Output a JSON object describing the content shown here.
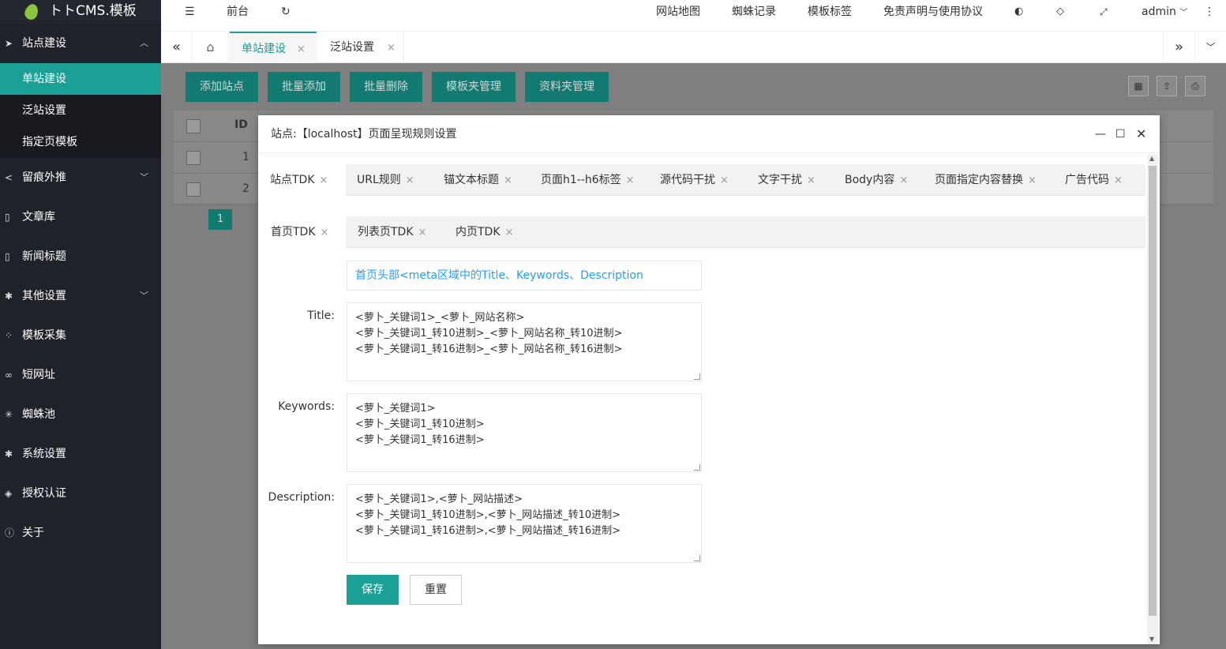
{
  "app": {
    "title": "トトCMS.模板"
  },
  "sidebar": {
    "items": [
      {
        "label": "站点建设",
        "icon": "send-icon",
        "arrow": "︿"
      },
      {
        "label": "留痕外推",
        "icon": "share-icon",
        "arrow": "﹀"
      },
      {
        "label": "文章库",
        "icon": "file-icon"
      },
      {
        "label": "新闻标题",
        "icon": "file-icon"
      },
      {
        "label": "其他设置",
        "icon": "gear-icon",
        "arrow": "﹀"
      },
      {
        "label": "模板采集",
        "icon": "loading-icon"
      },
      {
        "label": "短网址",
        "icon": "link-icon"
      },
      {
        "label": "蜘蛛池",
        "icon": "spider-icon"
      },
      {
        "label": "系统设置",
        "icon": "gear-icon"
      },
      {
        "label": "授权认证",
        "icon": "shield-icon"
      },
      {
        "label": "关于",
        "icon": "info-icon"
      }
    ],
    "subitems": [
      "单站建设",
      "泛站设置",
      "指定页模板"
    ]
  },
  "topbar": {
    "front": "前台",
    "links": [
      "网站地图",
      "蜘蛛记录",
      "模板标签",
      "免责声明与使用协议"
    ],
    "user": "admin"
  },
  "pagetabs": [
    "单站建设",
    "泛站设置"
  ],
  "toolbar": {
    "buttons": [
      "添加站点",
      "批量添加",
      "批量删除",
      "模板夹管理",
      "资料夹管理"
    ]
  },
  "table": {
    "id_header": "ID",
    "rows": [
      "1",
      "2"
    ],
    "page": "1"
  },
  "modal": {
    "title": "站点:【localhost】页面呈现规则设置",
    "tabs": [
      "站点TDK",
      "URL规则",
      "锚文本标题",
      "页面h1--h6标签",
      "源代码干扰",
      "文字干扰",
      "Body内容",
      "页面指定内容替换",
      "广告代码"
    ],
    "subtabs": [
      "首页TDK",
      "列表页TDK",
      "内页TDK"
    ],
    "note": "首页头部<meta区域中的Title、Keywords、Description",
    "fields": [
      {
        "label": "Title:",
        "value": "<萝卜_关键词1>_<萝卜_网站名称>\n<萝卜_关键词1_转10进制>_<萝卜_网站名称_转10进制>\n<萝卜_关键词1_转16进制>_<萝卜_网站名称_转16进制>"
      },
      {
        "label": "Keywords:",
        "value": "<萝卜_关键词1>\n<萝卜_关键词1_转10进制>\n<萝卜_关键词1_转16进制>"
      },
      {
        "label": "Description:",
        "value": "<萝卜_关键词1>,<萝卜_网站描述>\n<萝卜_关键词1_转10进制>,<萝卜_网站描述_转10进制>\n<萝卜_关键词1_转16进制>,<萝卜_网站描述_转16进制>"
      }
    ],
    "save": "保存",
    "reset": "重置"
  },
  "colors": {
    "accent": "#1aa094",
    "sidebar": "#20222a",
    "link": "#1e9fff"
  }
}
